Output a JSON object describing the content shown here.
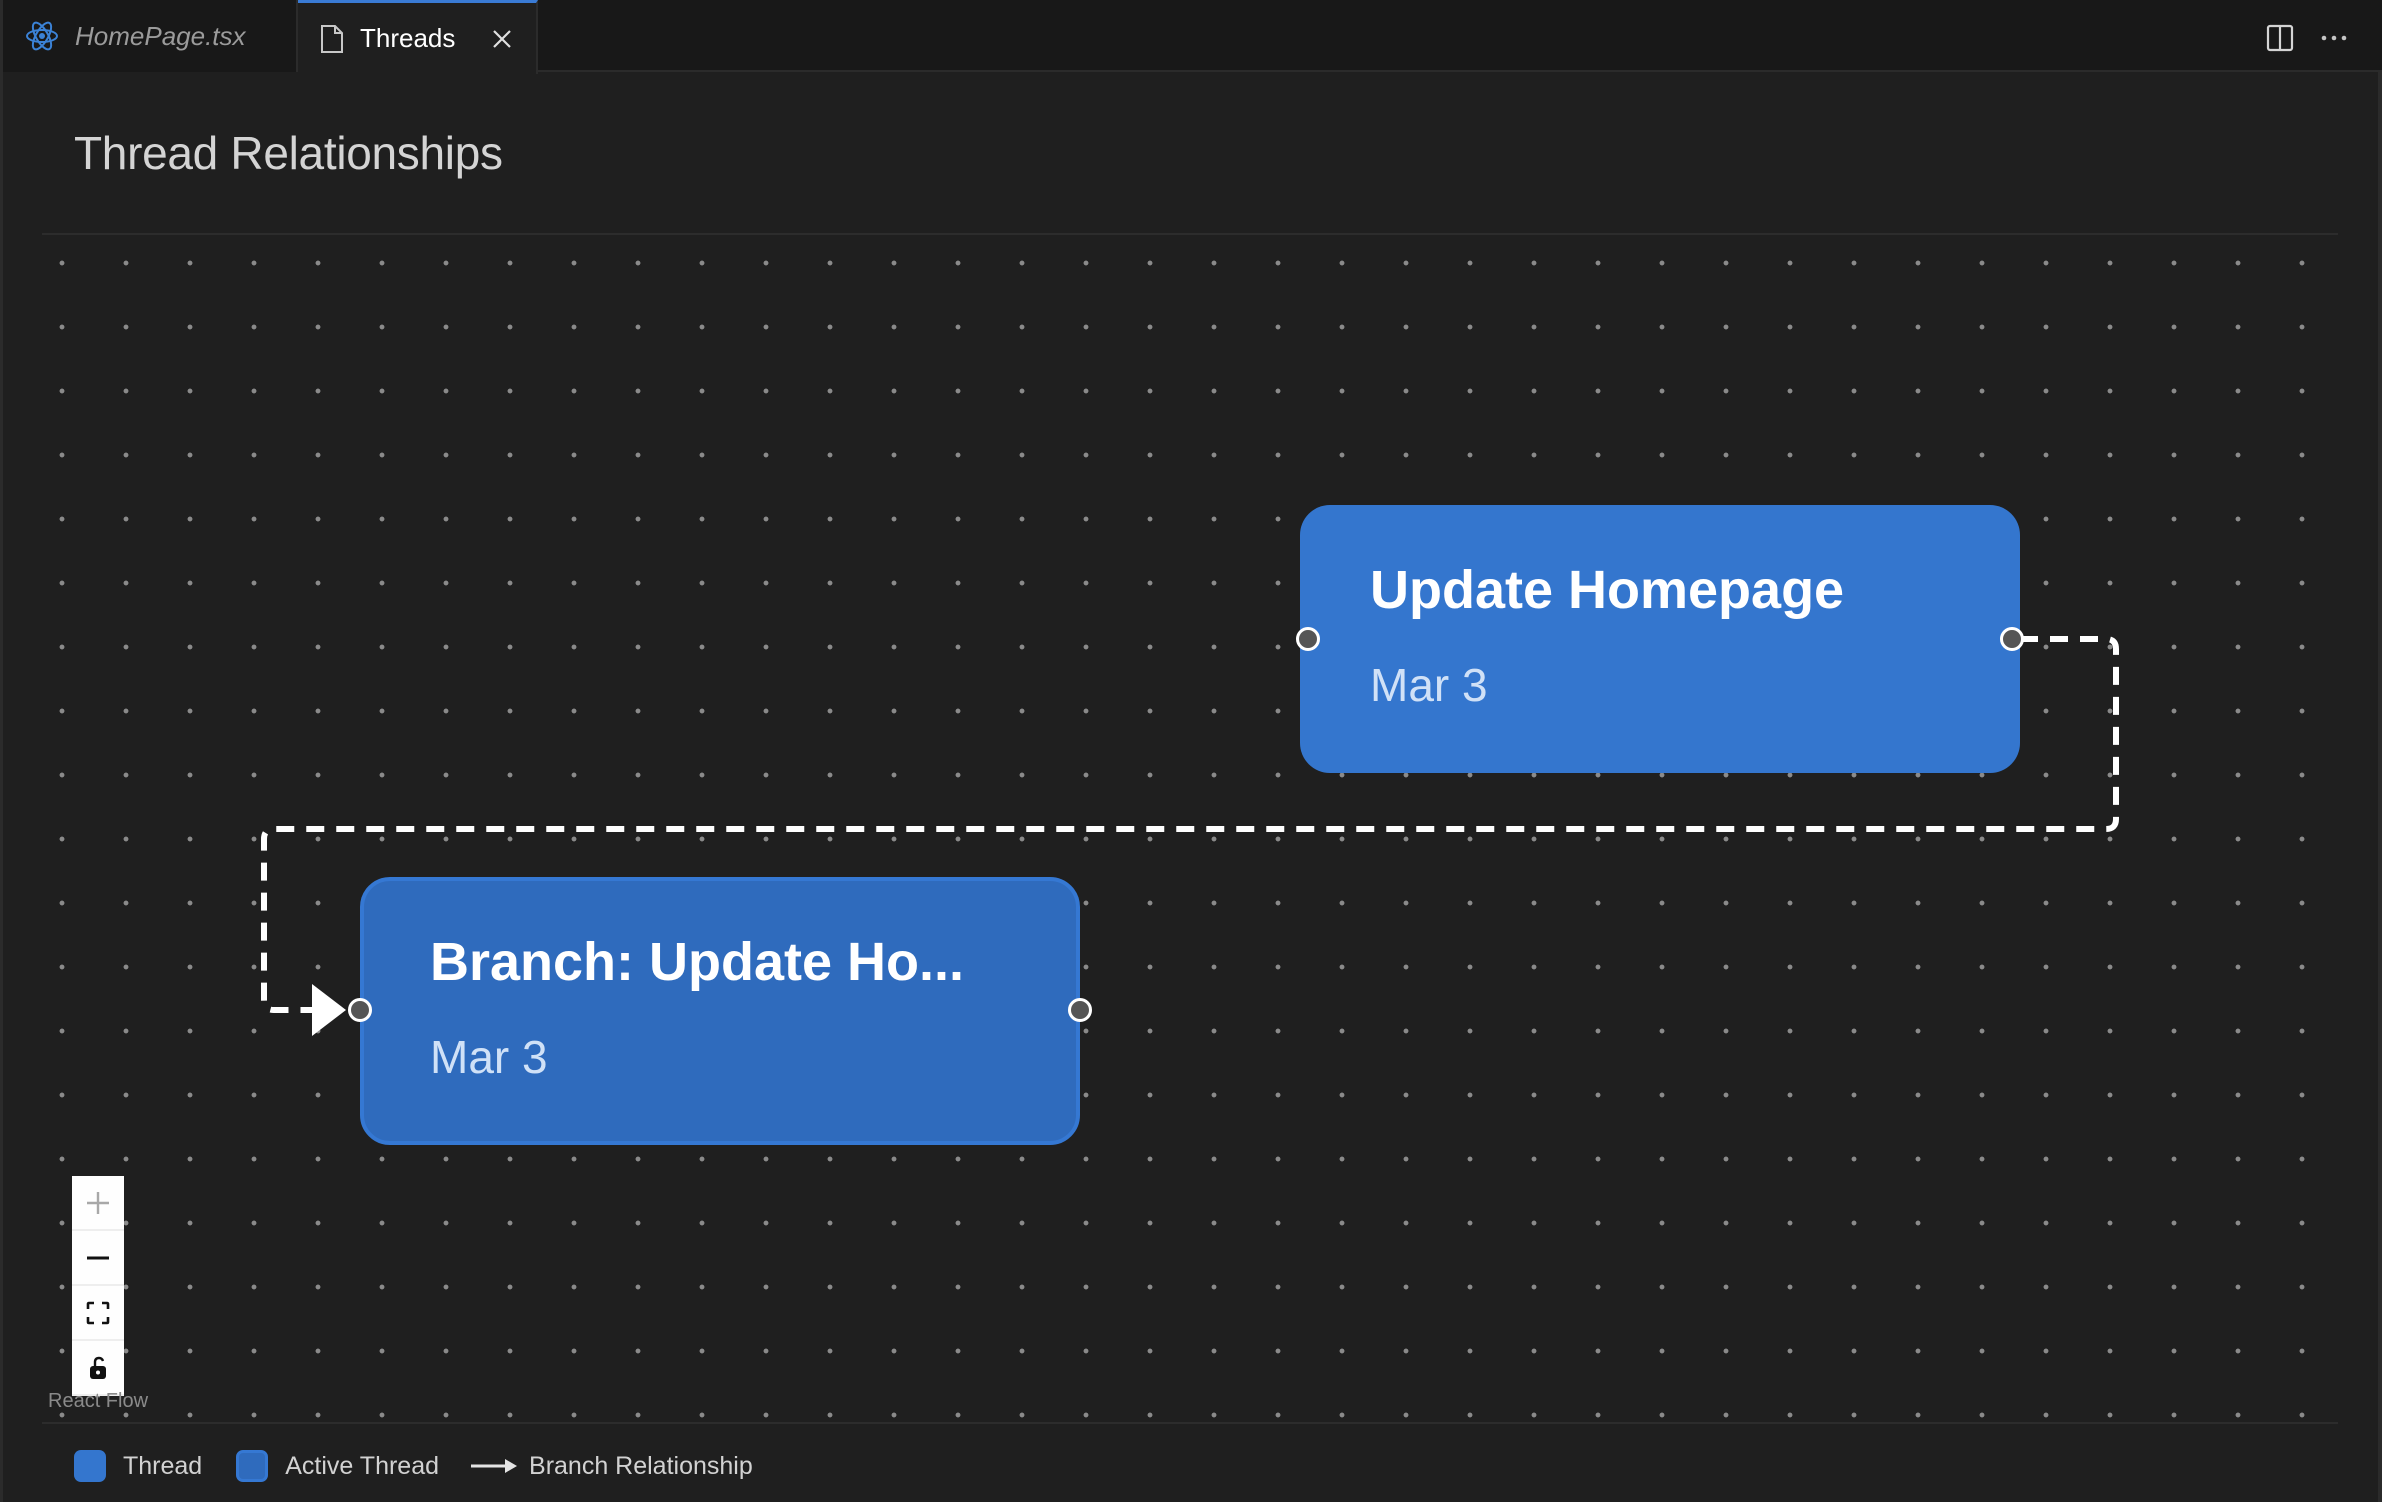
{
  "tabs": [
    {
      "label": "HomePage.tsx",
      "icon": "react-icon",
      "active": false
    },
    {
      "label": "Threads",
      "icon": "file-icon",
      "active": true,
      "closable": true
    }
  ],
  "toolbar": {
    "split_editor_icon": "split-editor-icon",
    "more_actions_icon": "ellipsis-icon"
  },
  "page": {
    "title": "Thread Relationships"
  },
  "colors": {
    "thread": "#3476ce",
    "active_thread": "#2f6bbd",
    "active_border": "#3578d3",
    "edge": "#ffffff",
    "tab_accent": "#3a7bd5"
  },
  "graph": {
    "nodes": [
      {
        "id": "update-homepage",
        "title": "Update Homepage",
        "date": "Mar 3",
        "active": false
      },
      {
        "id": "branch-update-homepage",
        "title": "Branch: Update Ho...",
        "date": "Mar 3",
        "active": true
      }
    ],
    "edges": [
      {
        "source": "update-homepage",
        "target": "branch-update-homepage",
        "type": "branch",
        "style": "dashed",
        "marker": "arrow"
      }
    ]
  },
  "controls": [
    {
      "name": "zoom-in",
      "icon": "plus-icon",
      "enabled": false
    },
    {
      "name": "zoom-out",
      "icon": "minus-icon",
      "enabled": true
    },
    {
      "name": "fit-view",
      "icon": "fit-view-icon",
      "enabled": true
    },
    {
      "name": "toggle-interactivity",
      "icon": "unlock-icon",
      "enabled": true
    }
  ],
  "attribution": "React Flow",
  "legend": [
    {
      "label": "Thread",
      "type": "swatch"
    },
    {
      "label": "Active Thread",
      "type": "swatch-active"
    },
    {
      "label": "Branch Relationship",
      "type": "arrow"
    }
  ]
}
